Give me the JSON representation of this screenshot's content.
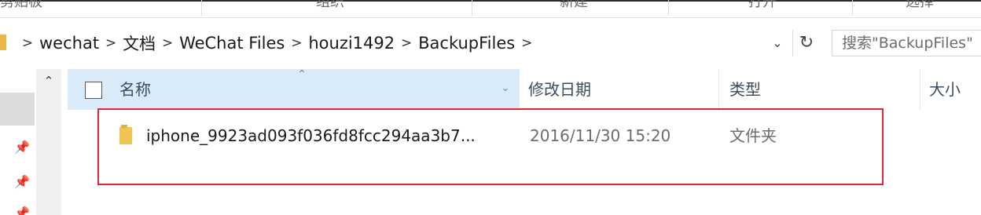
{
  "ribbon": {
    "groups": [
      {
        "label": "剪贴板"
      },
      {
        "label": "组织"
      },
      {
        "label": "新建"
      },
      {
        "label": "打开"
      },
      {
        "label": "选择"
      }
    ]
  },
  "address_bar": {
    "crumbs": [
      {
        "label": "wechat"
      },
      {
        "label": "文档"
      },
      {
        "label": "WeChat Files"
      },
      {
        "label": "houzi1492"
      },
      {
        "label": "BackupFiles"
      }
    ],
    "separator": ">",
    "dropdown_icon": "chevron-down-icon",
    "refresh_icon": "refresh-icon"
  },
  "search": {
    "placeholder": "搜索\"BackupFiles\""
  },
  "columns": {
    "name": "名称",
    "modified": "修改日期",
    "type": "类型",
    "size": "大小"
  },
  "files": [
    {
      "name": "iphone_9923ad093f036fd8fcc294aa3b7...",
      "modified": "2016/11/30 15:20",
      "type": "文件夹",
      "size": ""
    }
  ],
  "colors": {
    "header_selected_bg": "#d9ebf9",
    "folder_icon": "#efc453",
    "highlight_border": "#e32636"
  }
}
